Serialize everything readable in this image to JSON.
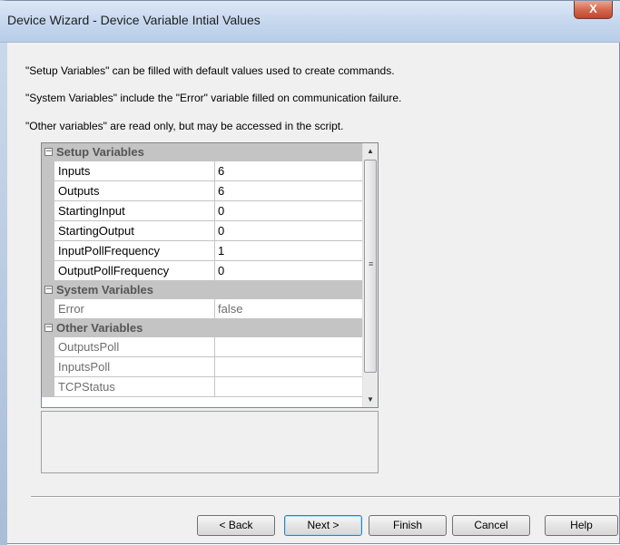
{
  "window": {
    "title": "Device Wizard - Device Variable Intial Values",
    "close_label": "X"
  },
  "info_lines": [
    "\"Setup Variables\" can be filled with default values used to create commands.",
    "\"System Variables\" include the \"Error\" variable filled on communication failure.",
    "\"Other variables\" are read only, but may be accessed in the script."
  ],
  "property_grid": {
    "collapse_glyph": "−",
    "categories": [
      {
        "label": "Setup Variables",
        "rows": [
          {
            "name": "Inputs",
            "value": "6"
          },
          {
            "name": "Outputs",
            "value": "6"
          },
          {
            "name": "StartingInput",
            "value": "0"
          },
          {
            "name": "StartingOutput",
            "value": "0"
          },
          {
            "name": "InputPollFrequency",
            "value": "1"
          },
          {
            "name": "OutputPollFrequency",
            "value": "0"
          }
        ]
      },
      {
        "label": "System Variables",
        "rows": [
          {
            "name": "Error",
            "value": "false"
          }
        ]
      },
      {
        "label": "Other Variables",
        "rows": [
          {
            "name": "OutputsPoll",
            "value": ""
          },
          {
            "name": "InputsPoll",
            "value": ""
          },
          {
            "name": "TCPStatus",
            "value": ""
          }
        ]
      }
    ]
  },
  "buttons": {
    "back": "< Back",
    "next": "Next >",
    "finish": "Finish",
    "cancel": "Cancel",
    "help": "Help"
  },
  "icons": {
    "scroll_up": "up-arrow-icon",
    "scroll_down": "down-arrow-icon",
    "collapse": "minus-box-icon"
  }
}
